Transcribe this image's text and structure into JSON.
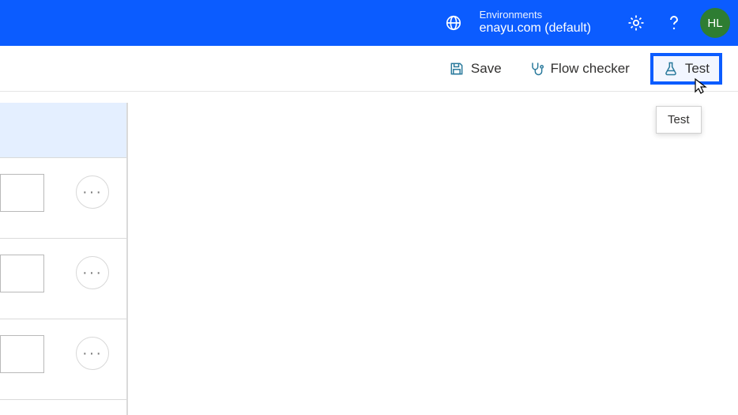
{
  "header": {
    "environments_label": "Environments",
    "environment_name": "enayu.com (default)",
    "avatar_initials": "HL"
  },
  "toolbar": {
    "save_label": "Save",
    "flow_checker_label": "Flow checker",
    "test_label": "Test"
  },
  "tooltip": {
    "test_tooltip_text": "Test"
  },
  "icons": {
    "globe": "globe-icon",
    "gear": "gear-icon",
    "help": "help-icon",
    "save": "save-icon",
    "stethoscope": "stethoscope-icon",
    "flask": "flask-icon",
    "more": "more-icon"
  },
  "colors": {
    "accent": "#0b5cff",
    "icon_teal": "#2a7a9c",
    "avatar_bg": "#2e7d32"
  }
}
